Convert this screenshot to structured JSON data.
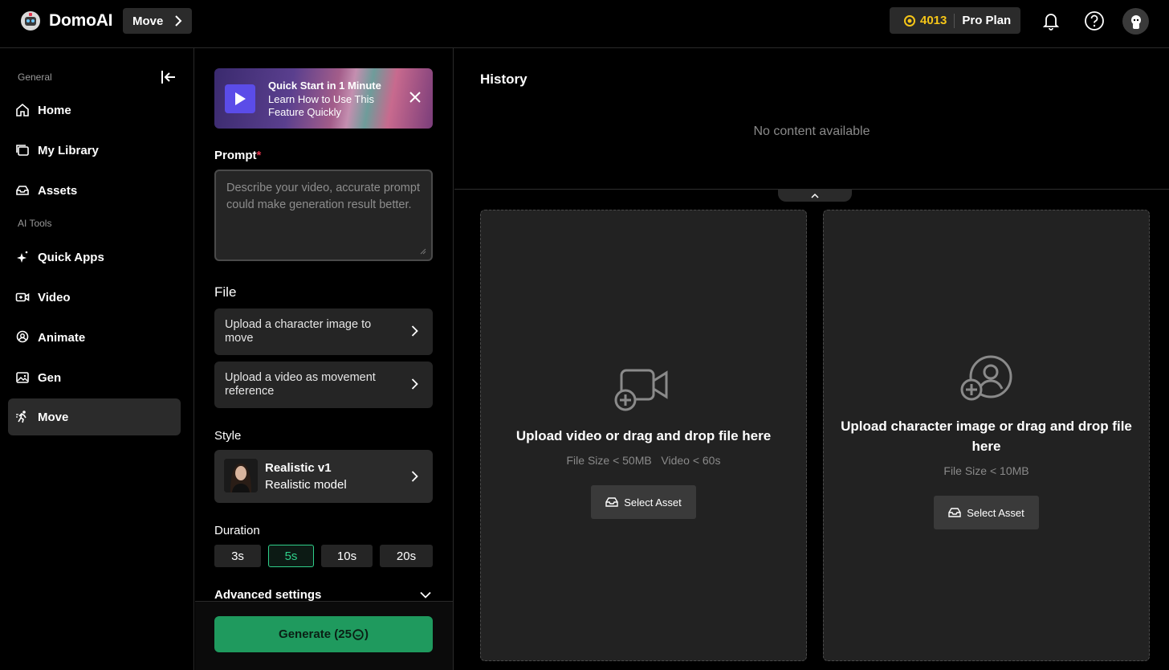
{
  "app": {
    "brand": "DomoAI",
    "breadcrumb": "Move"
  },
  "account": {
    "credits": "4013",
    "plan": "Pro Plan"
  },
  "sidebar": {
    "section_general": "General",
    "section_tools": "AI Tools",
    "items": [
      {
        "label": "Home",
        "icon": "home-icon"
      },
      {
        "label": "My Library",
        "icon": "library-icon"
      },
      {
        "label": "Assets",
        "icon": "assets-icon"
      },
      {
        "label": "Quick Apps",
        "icon": "sparkle-icon"
      },
      {
        "label": "Video",
        "icon": "video-icon"
      },
      {
        "label": "Animate",
        "icon": "animate-icon"
      },
      {
        "label": "Gen",
        "icon": "image-icon"
      },
      {
        "label": "Move",
        "icon": "move-icon",
        "active": true
      }
    ]
  },
  "banner": {
    "title": "Quick Start in 1 Minute",
    "subtitle": "Learn How to Use This Feature Quickly"
  },
  "prompt": {
    "label": "Prompt",
    "required_mark": "*",
    "placeholder": "Describe your video, accurate prompt could make generation result better."
  },
  "file": {
    "label": "File",
    "character_upload": "Upload a character image to move",
    "video_upload": "Upload a video as movement reference"
  },
  "style": {
    "label": "Style",
    "name": "Realistic v1",
    "description": "Realistic model"
  },
  "duration": {
    "label": "Duration",
    "options": [
      "3s",
      "5s",
      "10s",
      "20s"
    ],
    "selected": "5s"
  },
  "advanced": {
    "label": "Advanced settings"
  },
  "generate": {
    "label": "Generate (25",
    "suffix": ")"
  },
  "history": {
    "title": "History",
    "empty": "No content available"
  },
  "video_drop": {
    "title": "Upload video or drag and drop file here",
    "size_limit": "File Size < 50MB",
    "duration_limit": "Video < 60s",
    "button": "Select Asset"
  },
  "image_drop": {
    "title": "Upload character image or drag and drop file here",
    "size_limit": "File Size < 10MB",
    "button": "Select Asset"
  },
  "colors": {
    "accent_green": "#1f9a5e",
    "credit_yellow": "#f5c518",
    "required_red": "#e5334b"
  }
}
